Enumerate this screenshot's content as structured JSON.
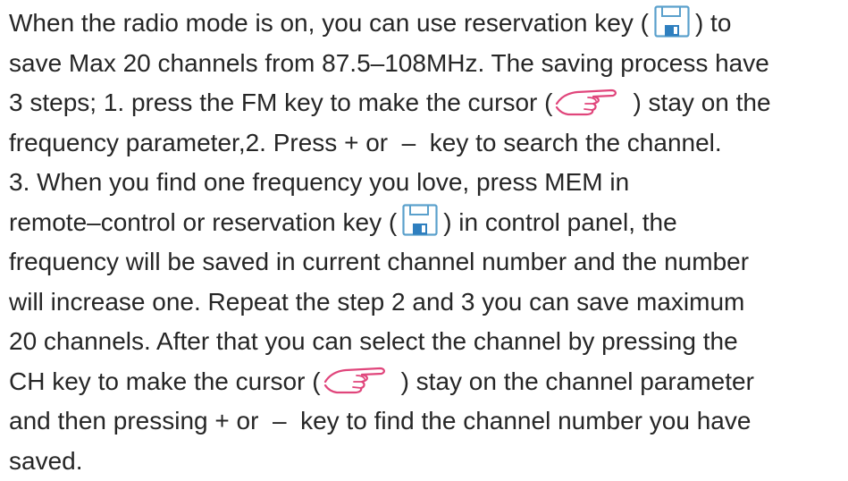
{
  "colors": {
    "text": "#262626",
    "save_icon_stroke": "#5aa0cc",
    "save_icon_fill": "#2e7fbf",
    "hand_icon_stroke": "#e0457b"
  },
  "icons": {
    "save": "floppy-disk-save-icon",
    "cursor": "pointing-hand-icon"
  },
  "paragraph": {
    "l1a": "When the radio mode is on, you can use reservation key (",
    "l1b": ") to",
    "l2": "save Max 20 channels from 87.5–108MHz. The saving process have",
    "l3a": "3 steps; 1. press the FM key to make the cursor (",
    "l3b": ") stay on the",
    "l4": "frequency parameter,2. Press + or  –  key to search the channel.",
    "l5": "3. When you find one frequency you love, press MEM in",
    "l6a": "remote–control or reservation key (",
    "l6b": ") in control panel, the",
    "l7": "frequency will be saved in current channel number and the number",
    "l8": "will increase one. Repeat the step 2 and 3 you can save maximum",
    "l9": "20 channels. After that you can select the channel by pressing the",
    "l10a": "CH key to make the cursor (",
    "l10b": ") stay on the channel parameter",
    "l11": "and then pressing + or  –  key to find the channel number you have",
    "l12": "saved."
  }
}
